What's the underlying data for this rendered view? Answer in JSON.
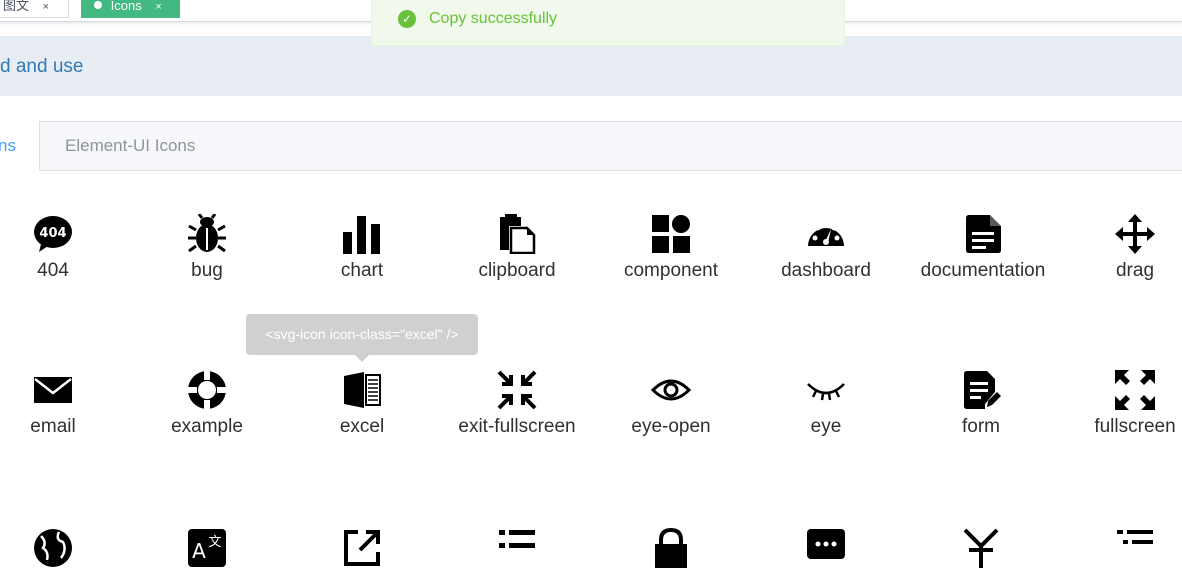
{
  "tags": [
    {
      "label": "图文",
      "close": "×"
    },
    {
      "label": "Icons",
      "close": "×",
      "active": true
    }
  ],
  "toast": {
    "message": "Copy successfully",
    "icon": "check-circle-icon",
    "color": "#67c23a"
  },
  "banner": {
    "link_text": "d and use"
  },
  "tabs": [
    {
      "label": "ns",
      "active": true
    },
    {
      "label": "Element-UI Icons",
      "active": false
    }
  ],
  "icons": {
    "row1": [
      "404",
      "bug",
      "chart",
      "clipboard",
      "component",
      "dashboard",
      "documentation",
      "drag"
    ],
    "row2": [
      "email",
      "example",
      "excel",
      "exit-fullscreen",
      "eye-open",
      "eye",
      "form",
      "fullscreen"
    ]
  },
  "tooltip": {
    "text": "<svg-icon icon-class=\"excel\" />"
  },
  "colors": {
    "accent": "#42b983",
    "link": "#409eff",
    "success": "#67c23a"
  }
}
